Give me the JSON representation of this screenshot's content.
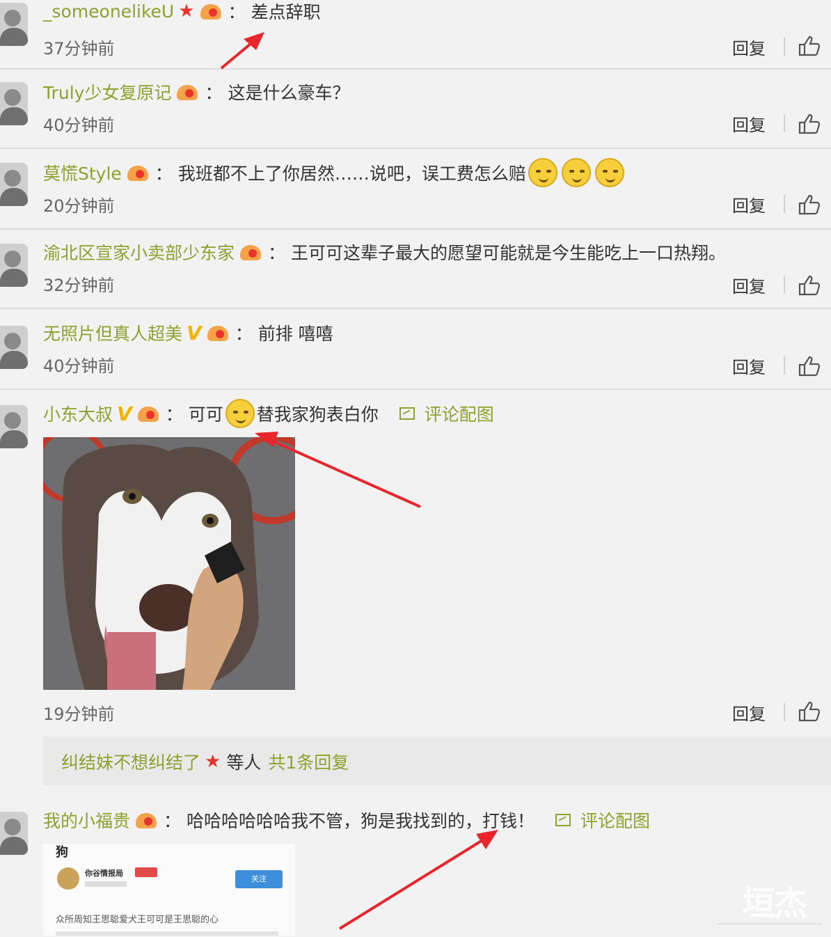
{
  "comments": [
    {
      "user": "_someonelikeU",
      "text": "差点辞职",
      "time": "37分钟前"
    },
    {
      "user": "Truly少女复原记",
      "text": "这是什么豪车？",
      "time": "40分钟前"
    },
    {
      "user": "莫慌Style",
      "text": "我班都不上了你居然……说吧，误工费怎么赔",
      "time": "20分钟前"
    },
    {
      "user": "渝北区宣家小卖部少东家",
      "text": "王可可这辈子最大的愿望可能就是今生能吃上一口热翔。",
      "time": "32分钟前"
    },
    {
      "user": "无照片但真人超美",
      "text": "前排 嘻嘻",
      "time": "40分钟前"
    },
    {
      "user": "小东大叔",
      "text_a": "可可",
      "text_b": "替我家狗表白你",
      "time": "19分钟前",
      "image_link": "评论配图"
    },
    {
      "user": "我的小福贵",
      "text": "哈哈哈哈哈哈我不管，狗是我找到的，打钱！",
      "image_link": "评论配图"
    }
  ],
  "reply_label": "回复",
  "colon": "：",
  "reply_thread": {
    "user": "纠结妹不想纠结了",
    "middle": "等人",
    "count": "共1条回复"
  },
  "card": {
    "title": "狗",
    "source": "你谷情报局",
    "follow": "关注",
    "body": "众所周知王思聪爱犬王可可是王思聪的心"
  },
  "watermark": "垣杰",
  "colors": {
    "username": "#8fa02f",
    "background": "#f2f2f2",
    "arrow": "#e8262b"
  }
}
